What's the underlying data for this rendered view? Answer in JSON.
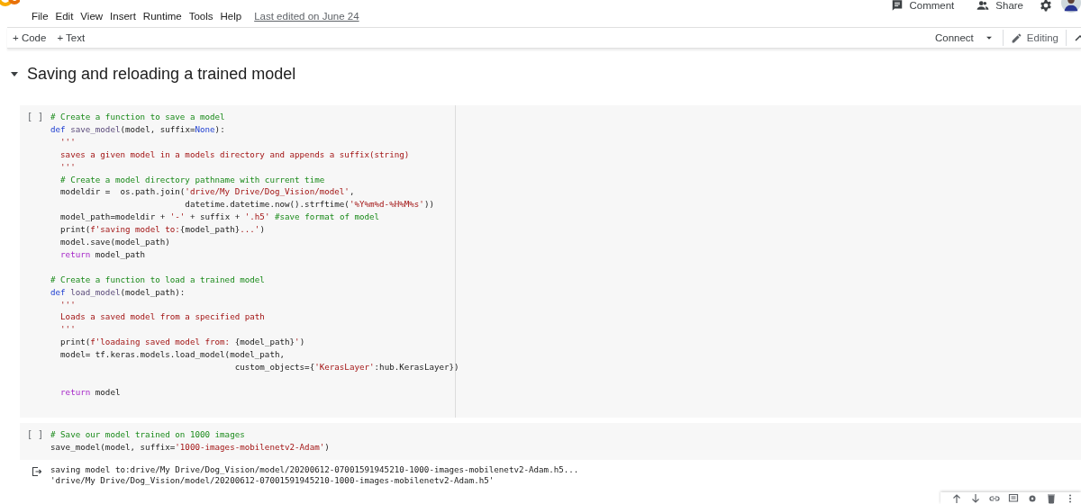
{
  "menu": {
    "items": [
      "File",
      "Edit",
      "View",
      "Insert",
      "Runtime",
      "Tools",
      "Help"
    ],
    "last_edited": "Last edited on June 24"
  },
  "header_actions": {
    "comment": "Comment",
    "share": "Share"
  },
  "toolbar": {
    "add_code": "+ Code",
    "add_text": "+ Text",
    "connect": "Connect",
    "editing": "Editing"
  },
  "section": {
    "title": "Saving and reloading a trained model",
    "expanded": true
  },
  "cells": [
    {
      "kind": "code",
      "run_label": "[ ]",
      "blocks": [
        [
          [
            {
              "kind": "comment",
              "text": "# Create a function to save a model"
            }
          ],
          [
            {
              "kind": "keyword",
              "text": "def"
            },
            {
              "kind": "name",
              "text": " save_model"
            },
            {
              "kind": "plain",
              "text": "(model, suffix="
            },
            {
              "kind": "keyword",
              "text": "None"
            },
            {
              "kind": "plain",
              "text": "):"
            }
          ],
          [
            {
              "kind": "string",
              "text": "  '''"
            }
          ],
          [
            {
              "kind": "string",
              "text": "  saves a given model in a models directory and appends a suffix(string)"
            }
          ],
          [
            {
              "kind": "string",
              "text": "  '''"
            }
          ],
          [
            {
              "kind": "comment",
              "text": "  # Create a model directory pathname with current time"
            }
          ],
          [
            {
              "kind": "plain",
              "text": "  modeldir =  os.path.join("
            },
            {
              "kind": "string",
              "text": "'drive/My Drive/Dog_Vision/model'"
            },
            {
              "kind": "plain",
              "text": ","
            }
          ],
          [
            {
              "kind": "plain",
              "text": "                           datetime.datetime.now().strftime("
            },
            {
              "kind": "string",
              "text": "'%Y%m%d-%H%M%s'"
            },
            {
              "kind": "plain",
              "text": "))"
            }
          ],
          [
            {
              "kind": "plain",
              "text": "  model_path=modeldir + "
            },
            {
              "kind": "string",
              "text": "'-'"
            },
            {
              "kind": "plain",
              "text": " + suffix + "
            },
            {
              "kind": "string",
              "text": "'.h5'"
            },
            {
              "kind": "comment",
              "text": " #save format of model"
            }
          ],
          [
            {
              "kind": "plain",
              "text": "  print("
            },
            {
              "kind": "string",
              "text": "f'saving model to:"
            },
            {
              "kind": "plain",
              "text": "{model_path}"
            },
            {
              "kind": "string",
              "text": "...'"
            },
            {
              "kind": "plain",
              "text": ")"
            }
          ],
          [
            {
              "kind": "plain",
              "text": "  model.save(model_path)"
            }
          ],
          [
            {
              "kind": "control",
              "text": "  return"
            },
            {
              "kind": "plain",
              "text": " model_path"
            }
          ]
        ],
        [
          [
            {
              "kind": "comment",
              "text": "# Create a function to load a trained model"
            }
          ],
          [
            {
              "kind": "keyword",
              "text": "def"
            },
            {
              "kind": "name",
              "text": " load_model"
            },
            {
              "kind": "plain",
              "text": "(model_path):"
            }
          ],
          [
            {
              "kind": "string",
              "text": "  '''"
            }
          ],
          [
            {
              "kind": "string",
              "text": "  Loads a saved model from a specified path"
            }
          ],
          [
            {
              "kind": "string",
              "text": "  '''"
            }
          ],
          [
            {
              "kind": "plain",
              "text": "  print("
            },
            {
              "kind": "string",
              "text": "f'loadaing saved model from: "
            },
            {
              "kind": "plain",
              "text": "{model_path}"
            },
            {
              "kind": "string",
              "text": "'"
            },
            {
              "kind": "plain",
              "text": ")"
            }
          ],
          [
            {
              "kind": "plain",
              "text": "  model= tf.keras.models.load_model(model_path,"
            }
          ],
          [
            {
              "kind": "plain",
              "text": "                                     custom_objects={"
            },
            {
              "kind": "string",
              "text": "'KerasLayer'"
            },
            {
              "kind": "plain",
              "text": ":hub.KerasLayer})"
            }
          ]
        ],
        [
          [
            {
              "kind": "control",
              "text": "  return"
            },
            {
              "kind": "plain",
              "text": " model"
            }
          ]
        ]
      ]
    },
    {
      "kind": "code",
      "run_label": "[ ]",
      "blocks": [
        [
          [
            {
              "kind": "comment",
              "text": "# Save our model trained on 1000 images"
            }
          ],
          [
            {
              "kind": "plain",
              "text": "save_model(model, suffix="
            },
            {
              "kind": "string",
              "text": "'1000-images-mobilenetv2-Adam'"
            },
            {
              "kind": "plain",
              "text": ")"
            }
          ]
        ]
      ]
    },
    {
      "kind": "output",
      "lines": [
        "saving model to:drive/My Drive/Dog_Vision/model/20200612-07001591945210-1000-images-mobilenetv2-Adam.h5...",
        "'drive/My Drive/Dog_Vision/model/20200612-07001591945210-1000-images-mobilenetv2-Adam.h5'"
      ]
    }
  ]
}
